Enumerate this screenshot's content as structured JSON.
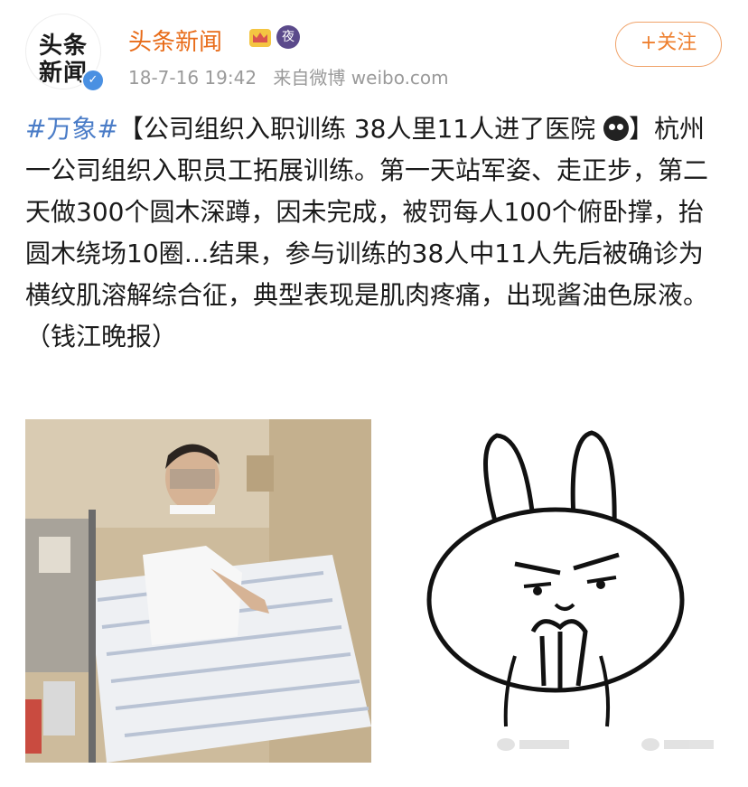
{
  "header": {
    "avatar_line1": "头条",
    "avatar_line2": "新闻",
    "name": "头条新闻",
    "night_badge": "夜",
    "time": "18-7-16 19:42",
    "source": "来自微博 weibo.com",
    "follow_label": "+关注"
  },
  "post": {
    "hashtag": "#万象#",
    "text_before_emoji": "【公司组织入职训练 38人里11人进了医院",
    "text_after_emoji": "】杭州一公司组织入职员工拓展训练。第一天站军姿、走正步，第二天做300个圆木深蹲，因未完成，被罚每人100个俯卧撑，抬圆木绕场10圈…结果，参与训练的38人中11人先后被确诊为横纹肌溶解综合征，典型表现是肌肉疼痛，出现酱油色尿液。（钱江晚报）"
  },
  "colors": {
    "name": "#e86c1a",
    "hashtag": "#4a7cc7",
    "follow_border": "#f0a36a",
    "verified": "#4a90e2"
  },
  "icons": [
    "verified-icon",
    "crown-icon",
    "night-icon",
    "emoji-icon"
  ]
}
